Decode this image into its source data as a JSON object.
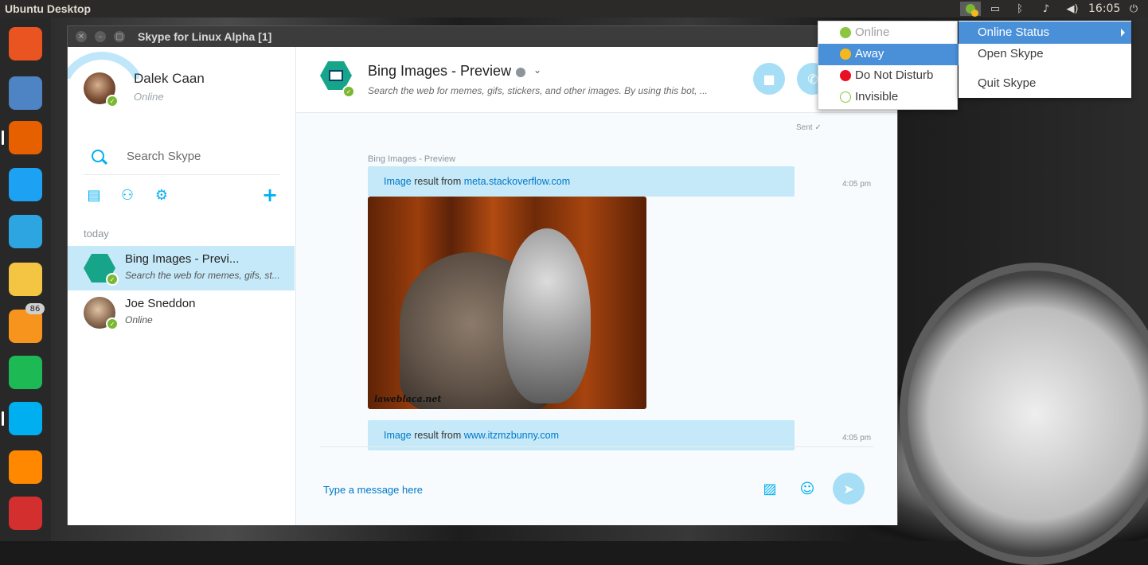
{
  "desktop": {
    "title": "Ubuntu Desktop"
  },
  "panel": {
    "time": "16:05",
    "indicators": [
      "skype-status-icon",
      "display-icon",
      "bluetooth-icon",
      "notification-bell-icon",
      "volume-icon",
      "clock",
      "power-icon"
    ]
  },
  "launcher": {
    "items": [
      {
        "name": "ubuntu-dash-icon",
        "color": "#e95420"
      },
      {
        "name": "files-icon",
        "color": "#4e84c4"
      },
      {
        "name": "firefox-icon",
        "color": "#e66000"
      },
      {
        "name": "twitter-icon",
        "color": "#1da1f2"
      },
      {
        "name": "telegram-icon",
        "color": "#2ca5e0"
      },
      {
        "name": "mail-icon",
        "color": "#f4c542"
      },
      {
        "name": "rss-reader-icon",
        "color": "#f7941d"
      },
      {
        "name": "spotify-icon",
        "color": "#1db954"
      },
      {
        "name": "skype-alpha-icon",
        "color": "#00aff0"
      },
      {
        "name": "vlc-icon",
        "color": "#ff8800"
      },
      {
        "name": "vivaldi-icon",
        "color": "#d32f2f"
      }
    ],
    "rss_badge": "86"
  },
  "window": {
    "title": "Skype for Linux Alpha [1]",
    "controls": [
      "close-button",
      "minimize-button",
      "maximize-button"
    ]
  },
  "profile": {
    "name": "Dalek Caan",
    "status": "Online",
    "status_color": "#7ab833"
  },
  "search": {
    "placeholder": "Search Skype"
  },
  "toolbar": [
    "contacts-icon",
    "add-bot-icon",
    "settings-gear-icon",
    "new-chat-plus-icon"
  ],
  "sidebar": {
    "section_label": "today",
    "conversations": [
      {
        "title": "Bing Images - Previ...",
        "subtitle": "Search the web for memes, gifs, st...",
        "active": true
      },
      {
        "title": "Joe Sneddon",
        "subtitle": "Online",
        "active": false
      }
    ]
  },
  "chat": {
    "title": "Bing Images - Preview",
    "subtitle": "Search the web for memes, gifs, stickers, and other images. By using this bot, ...",
    "sent_label": "Sent",
    "sender": "Bing Images - Preview",
    "messages": [
      {
        "prefix_link": "Image",
        "middle": " result from ",
        "domain": "meta.stackoverflow.com",
        "time": "4:05 pm"
      },
      {
        "prefix_link": "Image",
        "middle": " result from ",
        "domain": "www.itzmzbunny.com",
        "time": "4:05 pm"
      }
    ],
    "image_watermark": "laweblaca.net",
    "composer_placeholder": "Type a message here"
  },
  "status_menu": {
    "items": [
      {
        "label": "Online",
        "color": "#8cc63f",
        "state": "dim"
      },
      {
        "label": "Away",
        "color": "#f4b81e",
        "state": "highlighted"
      },
      {
        "label": "Do Not Disturb",
        "color": "#e81123",
        "state": "normal"
      },
      {
        "label": "Invisible",
        "color": "#8cc63f",
        "state": "normal"
      }
    ]
  },
  "indicator_menu": {
    "items": [
      {
        "label": "Online Status",
        "highlighted": true
      },
      {
        "label": "Open Skype",
        "highlighted": false
      },
      {
        "label": "Quit Skype",
        "highlighted": false
      }
    ]
  },
  "colors": {
    "accent": "#00aff0",
    "selection": "#c5e9f8",
    "menu_highlight": "#4a90d9"
  }
}
